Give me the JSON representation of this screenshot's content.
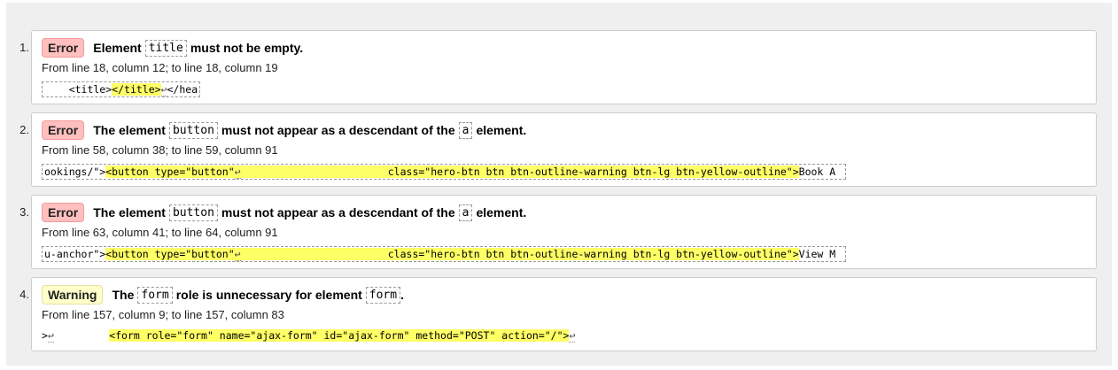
{
  "messages": [
    {
      "index": "1.",
      "type": "Error",
      "text_a": "Element",
      "code_a": "title",
      "text_b": "must not be empty.",
      "location": "From line 18, column 12; to line 18, column 19",
      "pre": "    <title>",
      "hl": "</title>",
      "lf": "↩",
      "post": "</hea"
    },
    {
      "index": "2.",
      "type": "Error",
      "text_a": "The element",
      "code_a": "button",
      "text_b": "must not appear as a descendant of the",
      "code_b": "a",
      "text_c": "element.",
      "location": "From line 58, column 38; to line 59, column 91",
      "pre": "ookings/\">",
      "hl": "<button type=\"button\"",
      "lf": "↩",
      "hl2": "                        class=\"hero-btn btn btn-outline-warning btn-lg btn-yellow-outline\">",
      "post": "Book A"
    },
    {
      "index": "3.",
      "type": "Error",
      "text_a": "The element",
      "code_a": "button",
      "text_b": "must not appear as a descendant of the",
      "code_b": "a",
      "text_c": "element.",
      "location": "From line 63, column 41; to line 64, column 91",
      "pre": "u-anchor\">",
      "hl": "<button type=\"button\"",
      "lf": "↩",
      "hl2": "                        class=\"hero-btn btn btn-outline-warning btn-lg btn-yellow-outline\">",
      "post": "View M"
    },
    {
      "index": "4.",
      "type": "Warning",
      "text_a": "The",
      "code_a": "form",
      "text_b": "role is unnecessary for element",
      "code_b": "form",
      "text_c": ".",
      "location": "From line 157, column 9; to line 157, column 83",
      "pre": ">",
      "lf": "↩",
      "gap": "         ",
      "hl": "<form role=\"form\" name=\"ajax-form\" id=\"ajax-form\" method=\"POST\" action=\"/\">",
      "lf2": "↩"
    }
  ]
}
